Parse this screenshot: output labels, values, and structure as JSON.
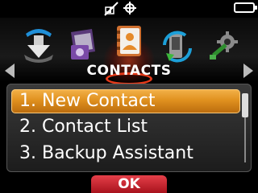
{
  "status_bar": {
    "icons": [
      "phone-off-icon",
      "gps-icon",
      "battery-icon"
    ]
  },
  "carousel": {
    "icons": [
      "download-icon",
      "media-icon",
      "contacts-icon",
      "sync-icon",
      "settings-icon"
    ],
    "selected": "contacts-icon",
    "selection_color": "#e53a1a"
  },
  "menu": {
    "title": "CONTACTS",
    "items": [
      {
        "label": "1. New Contact",
        "selected": true
      },
      {
        "label": "2. Contact List",
        "selected": false
      },
      {
        "label": "3. Backup Assistant",
        "selected": false
      }
    ],
    "highlight_color": "#e0911f"
  },
  "softkey": {
    "center_label": "OK"
  }
}
